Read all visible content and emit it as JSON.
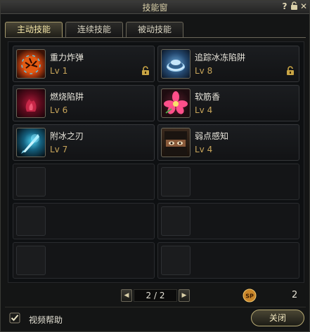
{
  "window": {
    "title": "技能窗"
  },
  "tabs": [
    {
      "label": "主动技能",
      "active": true
    },
    {
      "label": "连续技能",
      "active": false
    },
    {
      "label": "被动技能",
      "active": false
    }
  ],
  "skills": [
    {
      "name": "重力炸弹",
      "level": "Lv 1",
      "locked": true,
      "icon": "gravity-bomb-icon"
    },
    {
      "name": "追踪冰冻陷阱",
      "level": "Lv 8",
      "locked": true,
      "icon": "frost-trap-icon"
    },
    {
      "name": "燃烧陷阱",
      "level": "Lv 6",
      "locked": false,
      "icon": "burning-trap-icon"
    },
    {
      "name": "软筋香",
      "level": "Lv 4",
      "locked": false,
      "icon": "soft-incense-icon"
    },
    {
      "name": "附冰之刃",
      "level": "Lv 7",
      "locked": false,
      "icon": "ice-blade-icon"
    },
    {
      "name": "弱点感知",
      "level": "Lv 4",
      "locked": false,
      "icon": "weakness-sense-icon"
    }
  ],
  "pager": {
    "value": "2 / 2"
  },
  "sp": {
    "label": "SP",
    "value": "2"
  },
  "footer": {
    "help_label": "视频帮助",
    "close_label": "关闭"
  },
  "colors": {
    "accent": "#c8a55a",
    "text": "#e9e6dc",
    "frame": "#6a6658"
  }
}
